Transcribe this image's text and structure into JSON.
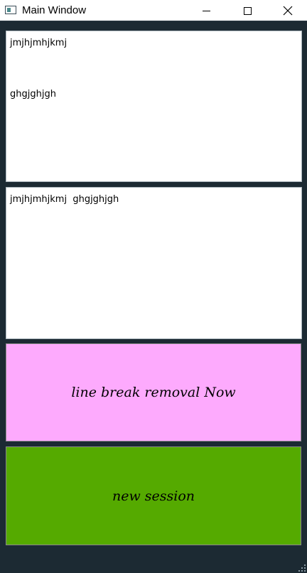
{
  "window": {
    "title": "Main Window",
    "icon": "app-window-icon",
    "controls": {
      "minimize_icon": "minimize-icon",
      "maximize_icon": "maximize-icon",
      "close_icon": "close-icon"
    }
  },
  "input_text": {
    "value": "jmjhjmhjkmj\n\n\n\nghgjghjgh"
  },
  "output_text": {
    "value": "jmjhjmhjkmj  ghgjghjgh"
  },
  "buttons": {
    "remove_label": "line break removal Now",
    "new_session_label": "new session"
  },
  "colors": {
    "background": "#1c2a33",
    "remove_button": "#fdaafd",
    "new_session_button": "#55aa00"
  }
}
